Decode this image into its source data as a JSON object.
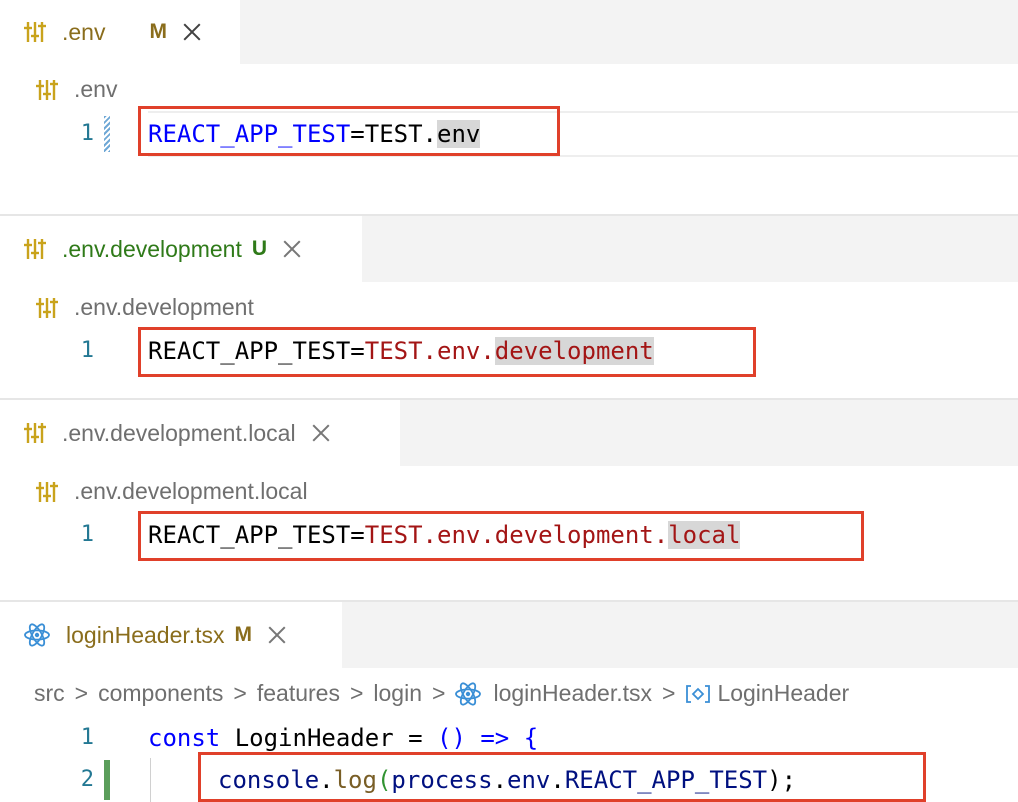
{
  "panels": [
    {
      "tab": {
        "name": ".env",
        "status": "M",
        "name_color": "#8a6d1c",
        "status_color": "#8a6d1c"
      },
      "breadcrumb": ".env",
      "line": {
        "number": "1",
        "parts": [
          "REACT_APP_TEST",
          "=",
          "TEST.",
          "env"
        ]
      }
    },
    {
      "tab": {
        "name": ".env.development",
        "status": "U",
        "name_color": "#2f7a19",
        "status_color": "#2f7a19"
      },
      "breadcrumb": ".env.development",
      "line": {
        "number": "1",
        "parts": [
          "REACT_APP_TEST=",
          "TEST.env.",
          "development"
        ]
      }
    },
    {
      "tab": {
        "name": ".env.development.local",
        "name_color": "#6f6f6f"
      },
      "breadcrumb": ".env.development.local",
      "line": {
        "number": "1",
        "parts": [
          "REACT_APP_TEST=",
          "TEST.env.development.",
          "local"
        ]
      }
    },
    {
      "tab": {
        "name": "loginHeader.tsx",
        "status": "M",
        "name_color": "#8a6d1c",
        "status_color": "#8a6d1c"
      },
      "breadcrumb": {
        "parts": [
          "src",
          "components",
          "features",
          "login",
          "loginHeader.tsx",
          "LoginHeader"
        ],
        "separator": ">"
      },
      "lines": [
        {
          "number": "1",
          "parts": [
            "const",
            " LoginHeader ",
            "=",
            " ",
            "()",
            " ",
            "=>",
            " ",
            "{"
          ]
        },
        {
          "number": "2",
          "parts": [
            "console",
            ".",
            "log",
            "(",
            "process",
            ".",
            "env",
            ".",
            "REACT_APP_TEST",
            ");"
          ]
        }
      ]
    }
  ],
  "icons": {
    "settings_file": "sliders-icon",
    "react_file": "react-atom-icon",
    "symbol": "symbol-module-icon"
  },
  "colors": {
    "accent_red_box": "#e0402a",
    "settings_icon": "#c9a31c",
    "react_icon": "#3a8fd6"
  }
}
